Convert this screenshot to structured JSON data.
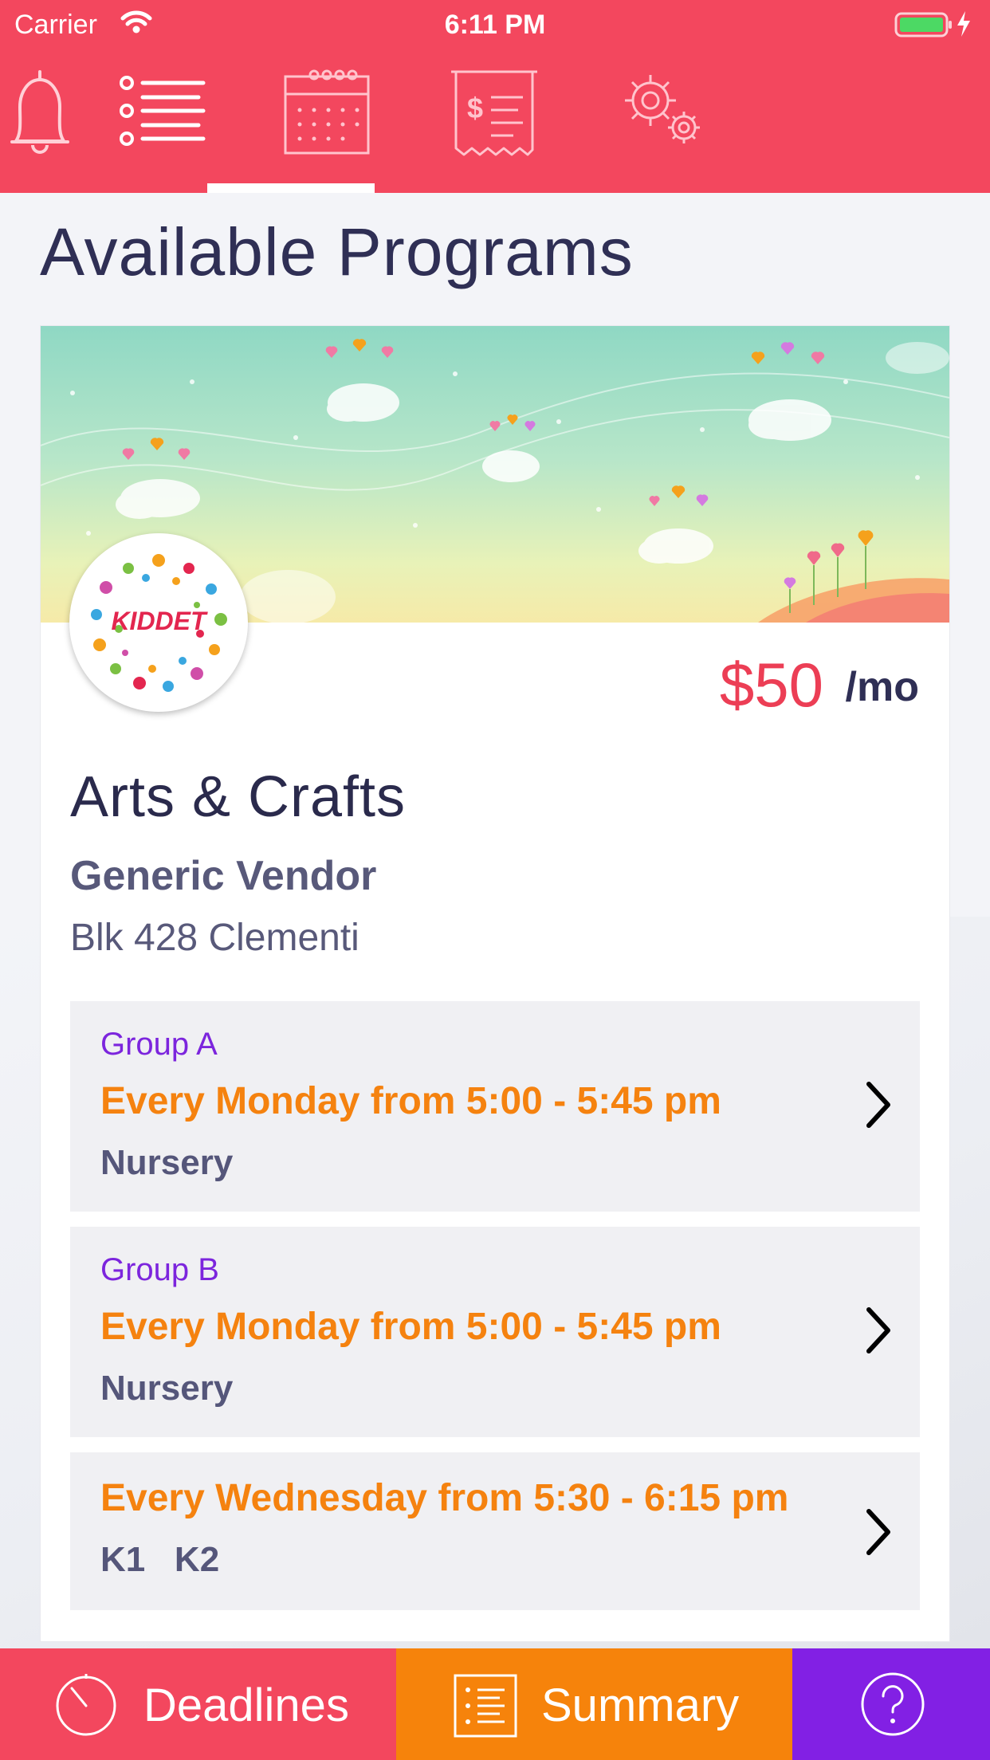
{
  "status_bar": {
    "carrier": "Carrier",
    "time": "6:11 PM"
  },
  "tabs": [
    {
      "icon": "bell-icon",
      "selected": false
    },
    {
      "icon": "list-icon",
      "selected": true
    },
    {
      "icon": "calendar-icon",
      "selected": false
    },
    {
      "icon": "invoice-icon",
      "selected": false
    },
    {
      "icon": "settings-gears-icon",
      "selected": false
    }
  ],
  "page": {
    "title": "Available Programs"
  },
  "program": {
    "logo_text": "KIDDET",
    "price": "$50",
    "price_unit": "/mo",
    "name": "Arts & Crafts",
    "vendor": "Generic Vendor",
    "address": "Blk 428 Clementi",
    "sessions": [
      {
        "group": "Group A",
        "time": "Every Monday from 5:00 - 5:45 pm",
        "levels": "Nursery"
      },
      {
        "group": "Group B",
        "time": "Every Monday from 5:00 - 5:45 pm",
        "levels": "Nursery"
      },
      {
        "group": "",
        "time": "Every Wednesday from 5:30 - 6:15 pm",
        "levels": "K1   K2"
      }
    ]
  },
  "bottom_bar": {
    "deadlines": "Deadlines",
    "summary": "Summary",
    "help_icon": "question-icon"
  },
  "colors": {
    "primary": "#f3475e",
    "summary": "#f6830b",
    "help": "#8220e4",
    "group_label": "#7c25dd",
    "time_text": "#f5820f"
  }
}
